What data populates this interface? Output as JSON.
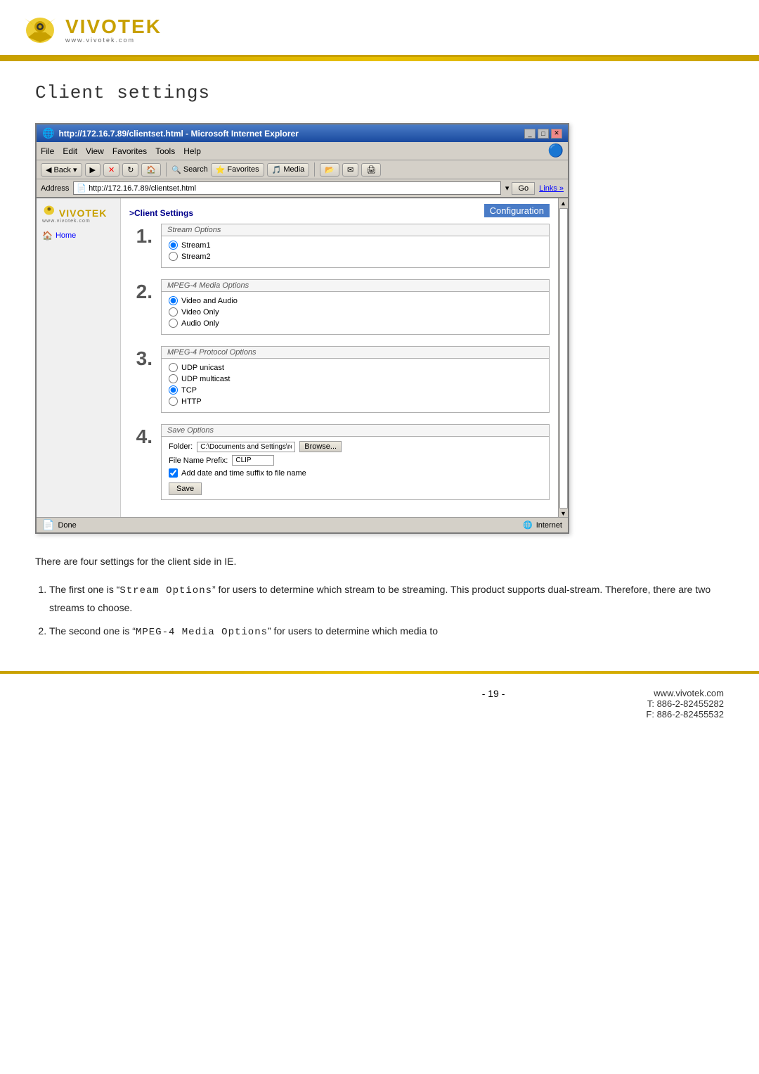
{
  "header": {
    "logo_main": "VIVOTEK",
    "logo_sub": "www.vivotek.com",
    "logo_bird_color": "#c8a000"
  },
  "browser": {
    "titlebar": {
      "title": "http://172.16.7.89/clientset.html - Microsoft Internet Explorer",
      "icon": "🌐",
      "controls": [
        "_",
        "□",
        "✕"
      ]
    },
    "menubar": {
      "items": [
        "File",
        "Edit",
        "View",
        "Favorites",
        "Tools",
        "Help"
      ]
    },
    "toolbar": {
      "back_label": "Back",
      "search_label": "Search",
      "favorites_label": "Favorites",
      "media_label": "Media"
    },
    "addressbar": {
      "label": "Address",
      "url": "http://172.16.7.89/clientset.html",
      "go_label": "Go",
      "links_label": "Links »"
    },
    "sidebar": {
      "logo_main": "VIVOTEK",
      "logo_sub": "www.vivotek.com",
      "nav_items": [
        "Home"
      ]
    },
    "config_label": "Configuration",
    "main": {
      "page_title": ">Client Settings",
      "sections": [
        {
          "step": "1.",
          "label": "Stream Options",
          "options": [
            "Stream1",
            "Stream2"
          ],
          "selected": 0
        },
        {
          "step": "2.",
          "label": "MPEG-4 Media Options",
          "options": [
            "Video and Audio",
            "Video Only",
            "Audio Only"
          ],
          "selected": 0
        },
        {
          "step": "3.",
          "label": "MPEG-4 Protocol Options",
          "options": [
            "UDP unicast",
            "UDP multicast",
            "TCP",
            "HTTP"
          ],
          "selected": 2
        },
        {
          "step": "4.",
          "label": "Save Options",
          "folder_label": "Folder:",
          "folder_value": "C:\\Documents and Settings\\re",
          "browse_label": "Browse...",
          "prefix_label": "File Name Prefix:",
          "prefix_value": "CLIP",
          "checkbox_label": "Add date and time suffix to file name",
          "checkbox_checked": true,
          "save_button": "Save"
        }
      ]
    },
    "statusbar": {
      "done_label": "Done",
      "internet_label": "Internet"
    }
  },
  "page_title": "Client settings",
  "body_text": "There are four settings for the client side in IE.",
  "body_items": [
    "The first one is “Stream Options” for users to determine which stream to be streaming. This product supports dual-stream. Therefore, there are two streams to choose.",
    "The second one is “MPEG-4 Media Options” for users to determine which media to"
  ],
  "footer": {
    "page_number": "- 19 -",
    "website": "www.vivotek.com",
    "phone": "T: 886-2-82455282",
    "fax": "F: 886-2-82455532"
  }
}
